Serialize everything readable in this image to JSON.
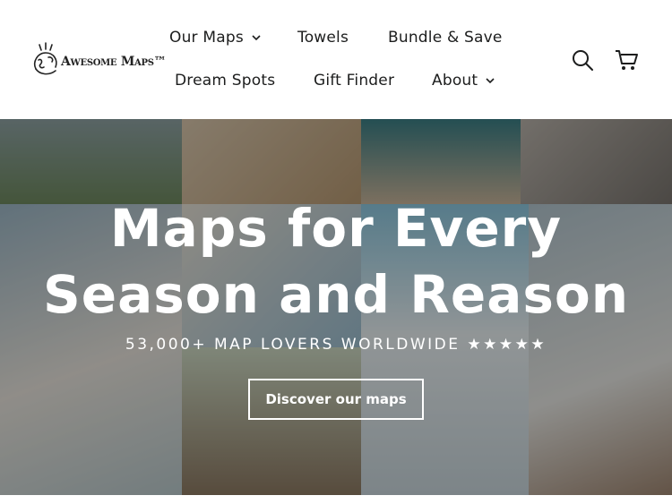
{
  "brand": {
    "name": "Awesome Maps™"
  },
  "nav": {
    "items": [
      {
        "label": "Our Maps",
        "has_dropdown": true
      },
      {
        "label": "Towels",
        "has_dropdown": false
      },
      {
        "label": "Bundle & Save",
        "has_dropdown": false
      },
      {
        "label": "Dream Spots",
        "has_dropdown": false
      },
      {
        "label": "Gift Finder",
        "has_dropdown": false
      },
      {
        "label": "About",
        "has_dropdown": true
      }
    ],
    "icons": [
      "search-icon",
      "cart-icon"
    ]
  },
  "hero": {
    "title_line1": "Maps for Every",
    "title_line2": "Season and Reason",
    "subtitle": "53,000+ MAP LOVERS WORLDWIDE ★★★★★",
    "cta_label": "Discover our maps"
  },
  "colors": {
    "text": "#1c1d1d",
    "overlay": "#000000",
    "hero_text": "#ffffff"
  }
}
